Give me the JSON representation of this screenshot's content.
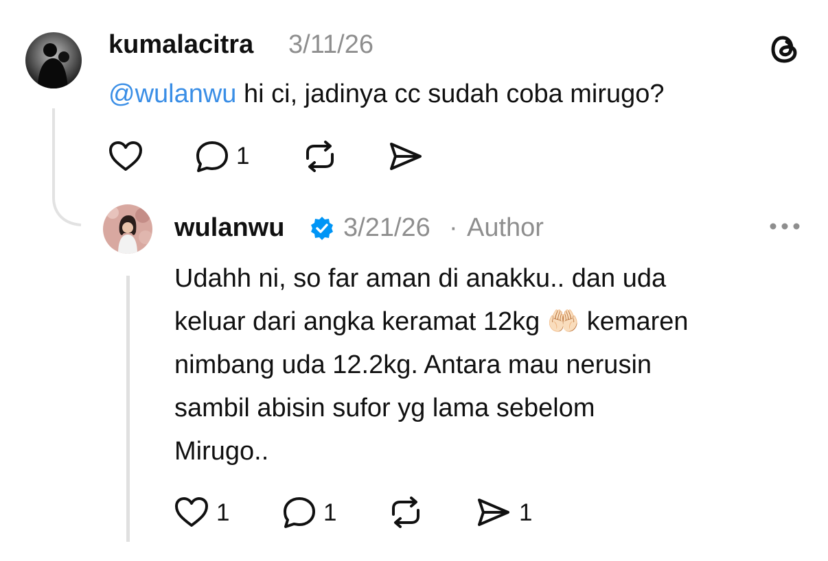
{
  "parent": {
    "username": "kumalacitra",
    "timestamp": "3/11/26",
    "mention": "@wulanwu",
    "text": " hi ci, jadinya cc sudah coba mirugo?",
    "actions": {
      "like_count": "",
      "reply_count": "1",
      "repost_count": "",
      "share_count": ""
    }
  },
  "reply": {
    "username": "wulanwu",
    "verified": true,
    "timestamp": "3/21/26",
    "separator": "·",
    "role": "Author",
    "lines": [
      "Udahh ni, so far aman di anakku.. dan uda",
      "keluar dari angka keramat 12kg 🤲🏻 kemaren",
      "nimbang uda 12.2kg. Antara mau nerusin",
      "sambil abisin sufor yg lama sebelom",
      "Mirugo.."
    ],
    "actions": {
      "like_count": "1",
      "reply_count": "1",
      "repost_count": "",
      "share_count": "1"
    }
  },
  "colors": {
    "mention": "#3a8ee6",
    "verified": "#0095f6",
    "muted": "#8e8e8e",
    "text": "#101010"
  },
  "icons": [
    "threads-logo-icon",
    "heart-icon",
    "comment-icon",
    "repost-icon",
    "share-icon",
    "more-icon",
    "verified-badge-icon"
  ]
}
